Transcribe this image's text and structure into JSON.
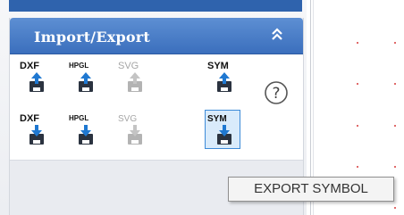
{
  "panel": {
    "group_title": "Import/Export",
    "collapse_icon": "double-chevron-up-icon",
    "help_icon": "question-circle-icon",
    "import_row": [
      {
        "label": "DXF",
        "icon": "import-arrow-up-icon",
        "enabled": true
      },
      {
        "label": "HPGL",
        "icon": "import-arrow-up-icon",
        "enabled": true
      },
      {
        "label": "SVG",
        "icon": "import-arrow-up-icon",
        "enabled": false
      },
      {
        "label": "SYM",
        "icon": "import-arrow-up-icon",
        "enabled": true
      }
    ],
    "export_row": [
      {
        "label": "DXF",
        "icon": "export-arrow-down-icon",
        "enabled": true
      },
      {
        "label": "HPGL",
        "icon": "export-arrow-down-icon",
        "enabled": true
      },
      {
        "label": "SVG",
        "icon": "export-arrow-down-icon",
        "enabled": false
      },
      {
        "label": "SYM",
        "icon": "export-arrow-down-icon",
        "enabled": true,
        "active": true
      }
    ]
  },
  "tooltip": {
    "text": "EXPORT SYMBOL"
  },
  "colors": {
    "header_top": "#5d8fd3",
    "header_bottom": "#3b6fbd",
    "icon_blue": "#1f78d1",
    "icon_dark": "#2b3340",
    "grid_dot": "#e06a6a",
    "active_border": "#3d8bd8"
  }
}
